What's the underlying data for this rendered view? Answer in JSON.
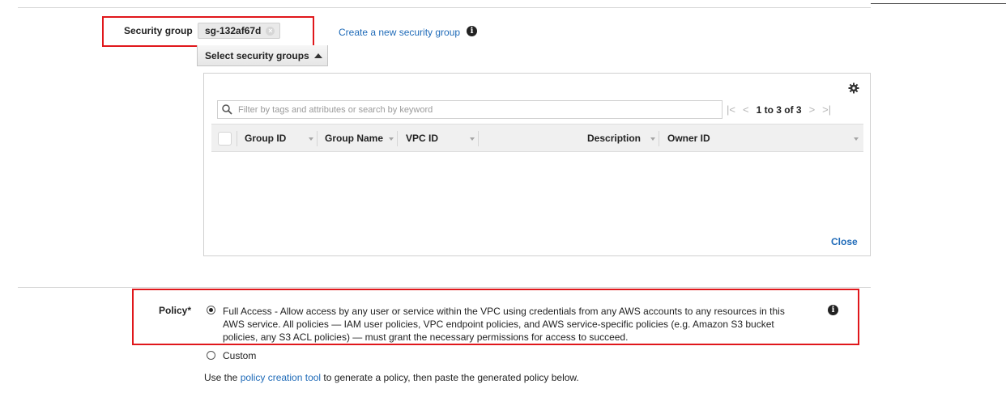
{
  "security_group": {
    "label": "Security group",
    "chip_value": "sg-132af67d",
    "create_link": "Create a new security group",
    "select_button": "Select security groups"
  },
  "table_panel": {
    "filter_placeholder": "Filter by tags and attributes or search by keyword",
    "pagination": "1 to 3 of 3",
    "columns": [
      "Group ID",
      "Group Name",
      "VPC ID",
      "Description",
      "Owner ID"
    ],
    "close_label": "Close"
  },
  "policy": {
    "label": "Policy*",
    "full_access_title": "Full Access",
    "full_access_text": " - Allow access by any user or service within the VPC using credentials from any AWS accounts to any resources in this AWS service. All policies — IAM user policies, VPC endpoint policies, and AWS service-specific policies (e.g. Amazon S3 bucket policies, any S3 ACL policies) — must grant the necessary permissions for access to succeed.",
    "custom_label": "Custom",
    "selected": "Full Access",
    "use_prefix": "Use the ",
    "tool_link": "policy creation tool",
    "use_suffix": " to generate a policy, then paste the generated policy below."
  },
  "colors": {
    "link": "#1e6ab8",
    "highlight_border": "#e0171b"
  }
}
